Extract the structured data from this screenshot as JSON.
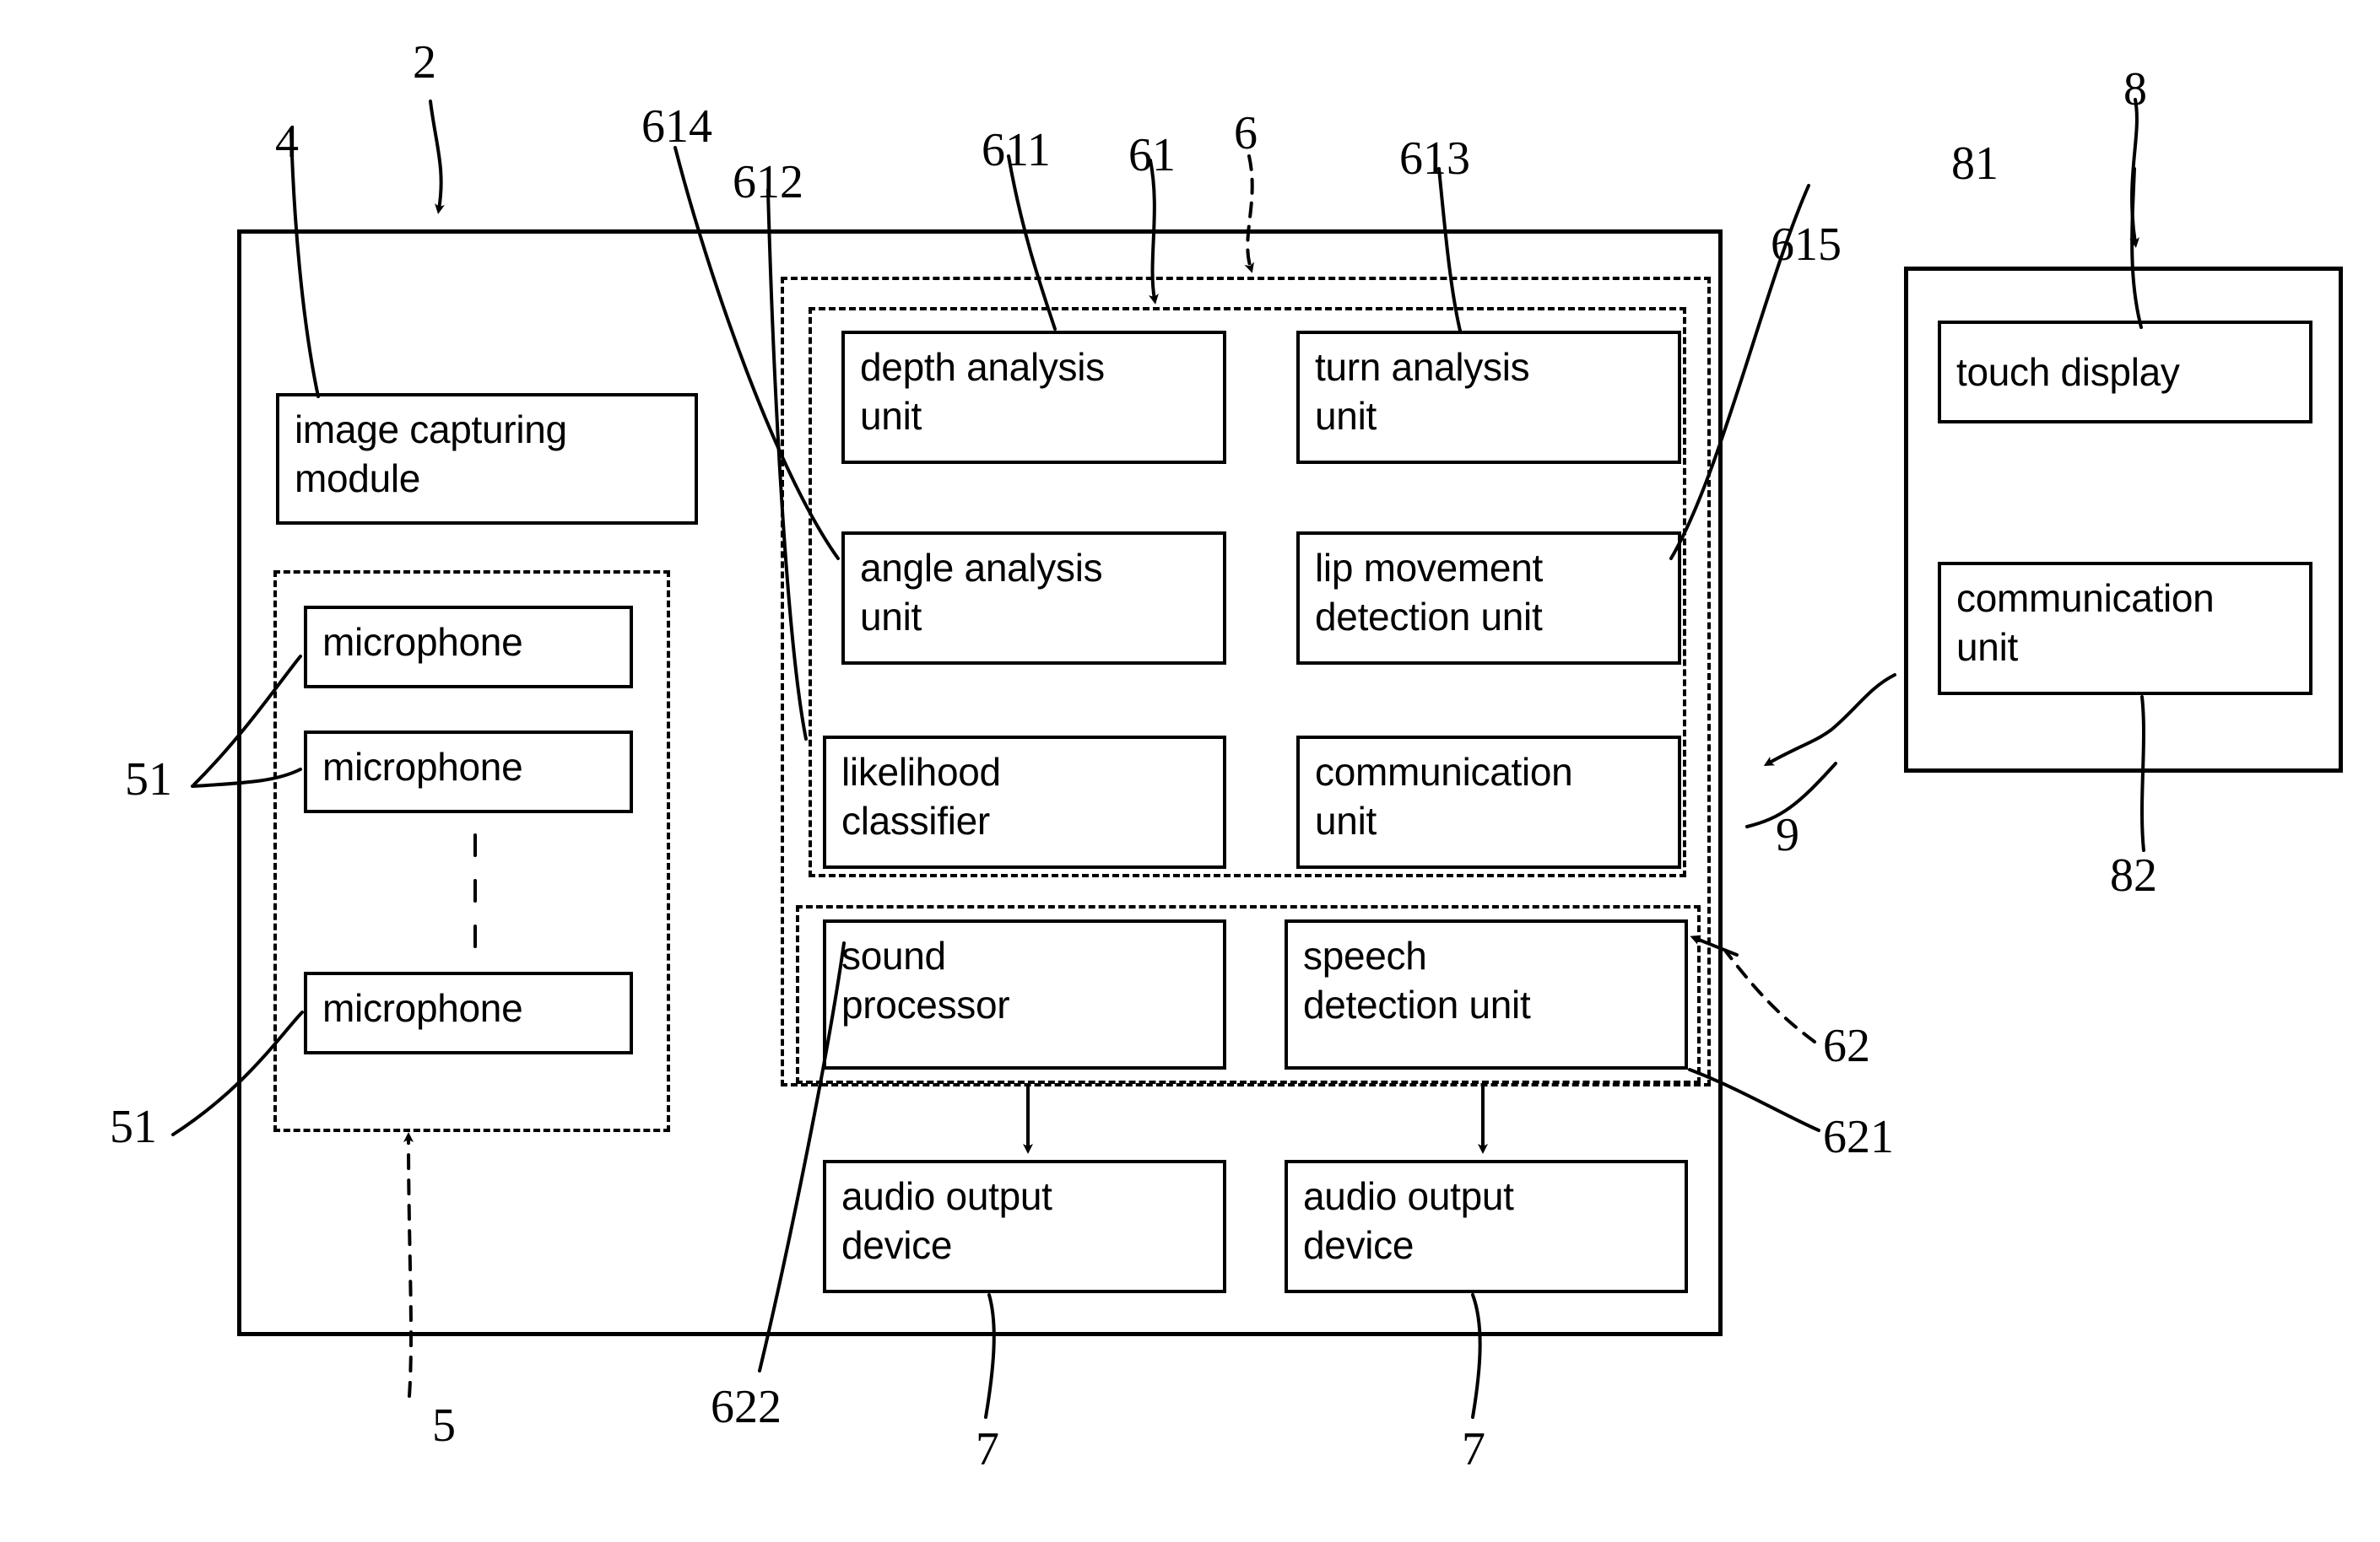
{
  "figure": {
    "type": "patent-block-diagram",
    "background": "#ffffff",
    "line_color": "#000000"
  },
  "blocks": {
    "image_capturing_module": "image capturing\nmodule",
    "microphone_1": "microphone",
    "microphone_2": "microphone",
    "microphone_3": "microphone",
    "depth_analysis_unit": "depth analysis\nunit",
    "turn_analysis_unit": "turn analysis\nunit",
    "angle_analysis_unit": "angle analysis\nunit",
    "lip_movement_detection_unit": "lip movement\ndetection unit",
    "likelihood_classifier": "likelihood\nclassifier",
    "communication_unit_inner": "communication\nunit",
    "sound_processor": "sound\nprocessor",
    "speech_detection_unit": "speech\ndetection unit",
    "audio_output_device_1": "audio output\ndevice",
    "audio_output_device_2": "audio output\ndevice",
    "touch_display": "touch display",
    "communication_unit_external": "communication\nunit"
  },
  "reference_numerals": {
    "n2": "2",
    "n4": "4",
    "n5": "5",
    "n6": "6",
    "n7_left": "7",
    "n7_right": "7",
    "n8": "8",
    "n9": "9",
    "n51_top": "51",
    "n51_bottom": "51",
    "n61": "61",
    "n62": "62",
    "n81": "81",
    "n82": "82",
    "n611": "611",
    "n612": "612",
    "n613": "613",
    "n614": "614",
    "n615": "615",
    "n621": "621",
    "n622": "622"
  }
}
